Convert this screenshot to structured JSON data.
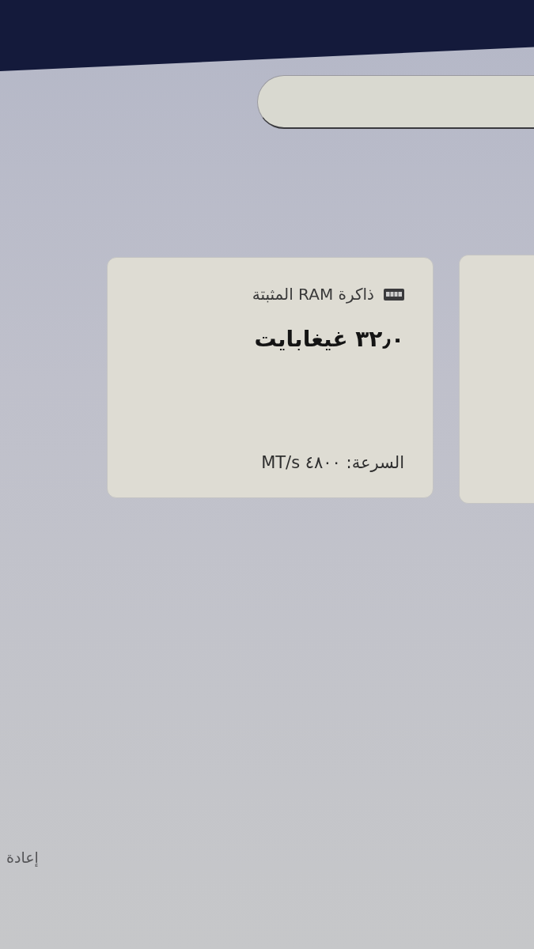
{
  "cards": [
    {
      "title": "ذاكرة RAM المثبتة",
      "value": "٣٢٫٠ غيغابايت",
      "detail": "السرعة: ٤٨٠٠ MT/s"
    }
  ],
  "footer": {
    "action": "إعادة"
  }
}
